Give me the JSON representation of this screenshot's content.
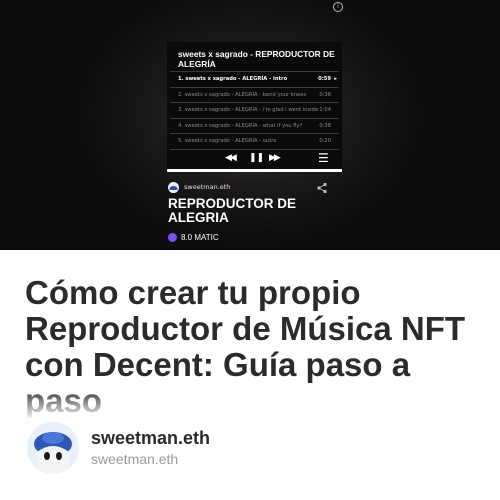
{
  "hero": {
    "player": {
      "title": "sweets x sagrado - REPRODUCTOR DE ALEGRÍA",
      "tracks": [
        {
          "name": "1. sweets x sagrado - ALEGRÍA - intro",
          "duration": "0:59",
          "active": true
        },
        {
          "name": "2. sweets x sagrado - ALEGRÍA - bend your knees",
          "duration": "0:36",
          "active": false
        },
        {
          "name": "3. sweets x sagrado - ALEGRÍA - i'm glad i went inside",
          "duration": "1:04",
          "active": false
        },
        {
          "name": "4. sweets x sagrado - ALEGRÍA - what if you fly?",
          "duration": "0:38",
          "active": false
        },
        {
          "name": "5. sweets x sagrado - ALEGRÍA - outro",
          "duration": "0:20",
          "active": false
        }
      ],
      "controls": {
        "rewind": "◀◀",
        "pause": "❚❚",
        "forward": "▶▶",
        "playlist": "☰"
      }
    },
    "creator": "sweetman.eth",
    "nft_title": "REPRODUCTOR DE ALEGRIA",
    "price": "8.0 MATIC"
  },
  "article": {
    "title": "Cómo crear tu propio Reproductor de Música NFT con Decent: Guía paso a paso"
  },
  "author": {
    "name": "sweetman.eth",
    "handle": "sweetman.eth"
  }
}
